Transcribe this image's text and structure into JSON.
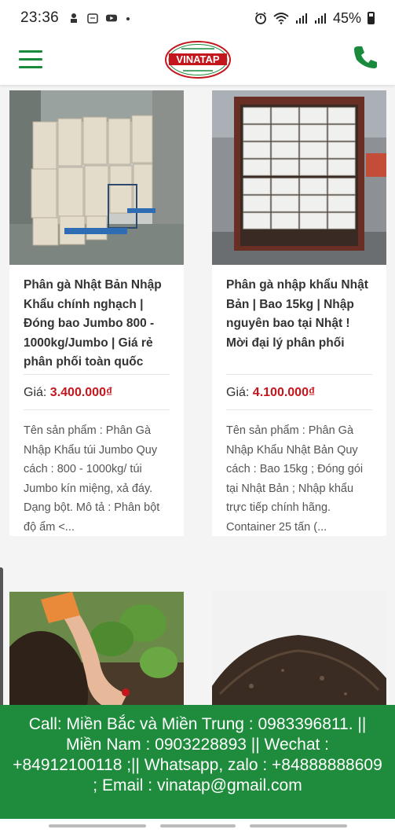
{
  "status_bar": {
    "time": "23:36",
    "battery": "45%"
  },
  "header": {
    "logo_text": "VINATAP",
    "menu_icon": "hamburger-menu-icon",
    "phone_icon": "phone-icon",
    "brand_color": "#1a8a3c"
  },
  "products": [
    {
      "title": "Phân gà Nhật Bản Nhập Khẩu chính nghạch | Đóng bao Jumbo 800 - 1000kg/Jumbo | Giá rẻ phân phối toàn quốc",
      "price_label": "Giá:",
      "price": "3.400.000₫",
      "description": "Tên sản phẩm : Phân Gà Nhập Khẩu túi Jumbo Quy cách : 800 - 1000kg/ túi Jumbo kín miệng, xả đáy. Dạng bột. Mô tả : Phân bột độ ẩm <..."
    },
    {
      "title": "Phân gà nhập khẩu Nhật Bản | Bao 15kg | Nhập nguyên bao tại Nhật ! Mời đại lý phân phối",
      "price_label": "Giá:",
      "price": "4.100.000₫",
      "description": "Tên sản phẩm : Phân Gà Nhập Khẩu Nhật Bản Quy cách : Bao 15kg ; Đóng gói tại Nhật Bản ; Nhập khẩu trực tiếp chính hãng. Container 25 tấn (..."
    }
  ],
  "contact_bar": {
    "text": "Call: Miền Bắc và Miền Trung : 0983396811. || Miền Nam : 0903228893 || Wechat : +84912100118 ;|| Whatsapp, zalo : +84888888609 ; Email : vinatap@gmail.com",
    "background": "#1e8c3c"
  },
  "price_color": "#c4161c"
}
